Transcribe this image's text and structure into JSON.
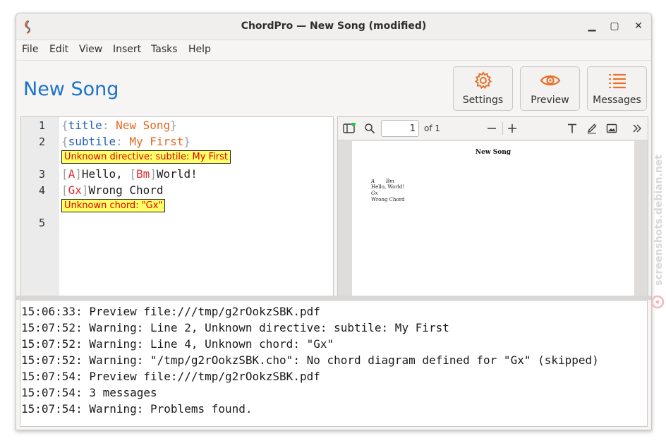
{
  "window": {
    "title": "ChordPro — New Song (modified)",
    "min_glyph": "▁",
    "max_glyph": "▢",
    "close_glyph": "✕"
  },
  "menu": [
    "File",
    "Edit",
    "View",
    "Insert",
    "Tasks",
    "Help"
  ],
  "song_title": "New Song",
  "toolbar": {
    "settings": "Settings",
    "preview": "Preview",
    "messages": "Messages",
    "accent": "#e8702a"
  },
  "editor": {
    "line_numbers": [
      "1",
      "2",
      "3",
      "4",
      "5"
    ],
    "line1": {
      "open": "{",
      "directive": "title",
      "colon": ": ",
      "value": "New Song",
      "close": "}"
    },
    "line2": {
      "open": "{",
      "directive": "subtile",
      "colon": ": ",
      "value": "My First",
      "close": "}"
    },
    "line3": {
      "c1": "A",
      "t1": "Hello, ",
      "c2": "Bm",
      "t2": "World!"
    },
    "line4": {
      "c1": "Gx",
      "t1": "Wrong Chord"
    },
    "error1": "Unknown directive: subtile: My First",
    "error2": "Unknown chord: \"Gx\""
  },
  "preview": {
    "page_number": "1",
    "page_of": "of 1",
    "doc": {
      "title": "New Song",
      "chords1": [
        "A",
        "Bm"
      ],
      "lyrics1": "Hello, World!",
      "chords2": [
        "Gx"
      ],
      "lyrics2": "Wrong Chord"
    }
  },
  "messages": [
    "15:06:33: Preview file:///tmp/g2rOokzSBK.pdf",
    "15:07:52: Warning: Line 2, Unknown directive: subtile: My First",
    "15:07:52: Warning: Line 4, Unknown chord: \"Gx\"",
    "15:07:52: Warning: \"/tmp/g2rOokzSBK.cho\": No chord diagram defined for \"Gx\" (skipped)",
    "15:07:54: Preview file:///tmp/g2rOokzSBK.pdf",
    "15:07:54: 3 messages",
    "15:07:54: Warning: Problems found."
  ],
  "watermark": "screenshots.debian.net"
}
